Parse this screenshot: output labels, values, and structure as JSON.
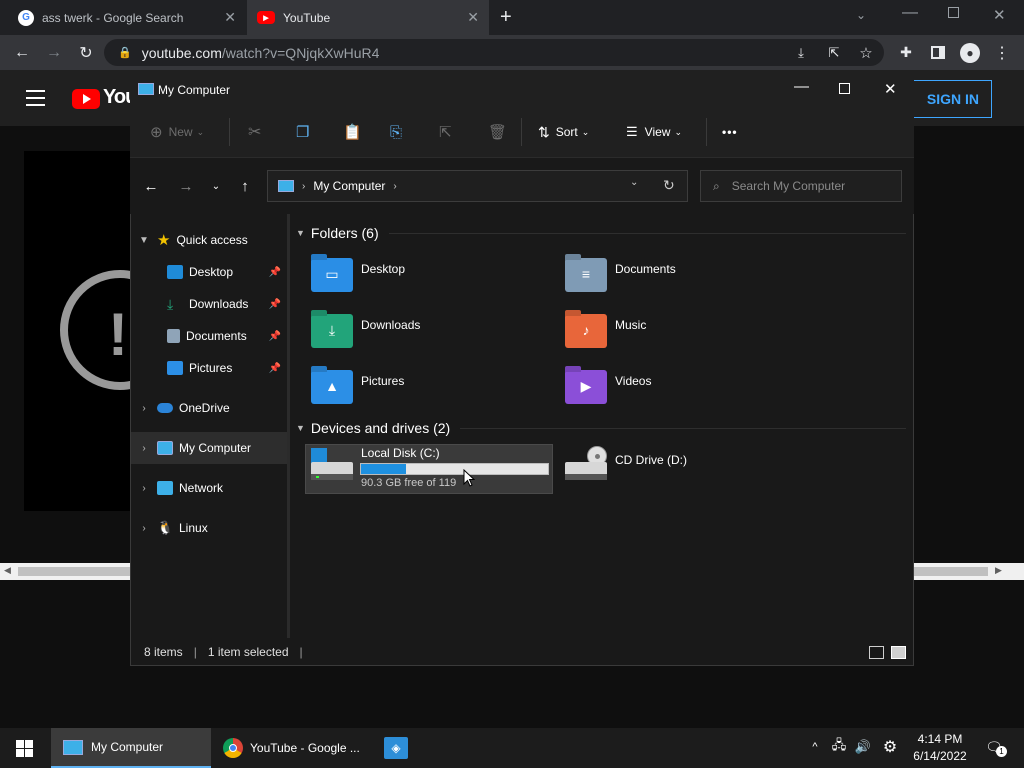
{
  "browser": {
    "tabs": [
      {
        "title": "ass twerk - Google Search",
        "favicon": "google-icon"
      },
      {
        "title": "YouTube",
        "favicon": "youtube-icon"
      }
    ],
    "url_host": "youtube.com",
    "url_path": "/watch?v=QNjqkXwHuR4"
  },
  "youtube": {
    "logo_text": "You",
    "signin_label": "SIGN IN"
  },
  "explorer": {
    "title": "My Computer",
    "command_bar": {
      "new_label": "New",
      "sort_label": "Sort",
      "view_label": "View",
      "more_label": "•••"
    },
    "address": {
      "location": "My Computer",
      "search_placeholder": "Search My Computer"
    },
    "sidebar": [
      {
        "label": "Quick access",
        "icon": "star-icon",
        "level": 0,
        "expanded": true
      },
      {
        "label": "Desktop",
        "icon": "desktop-icon",
        "level": 1,
        "pinned": true
      },
      {
        "label": "Downloads",
        "icon": "download-icon",
        "level": 1,
        "pinned": true
      },
      {
        "label": "Documents",
        "icon": "document-icon",
        "level": 1,
        "pinned": true
      },
      {
        "label": "Pictures",
        "icon": "picture-icon",
        "level": 1,
        "pinned": true
      },
      {
        "label": "OneDrive",
        "icon": "cloud-icon",
        "level": 0
      },
      {
        "label": "My Computer",
        "icon": "computer-icon",
        "level": 0,
        "selected": true
      },
      {
        "label": "Network",
        "icon": "network-icon",
        "level": 0
      },
      {
        "label": "Linux",
        "icon": "linux-icon",
        "level": 0
      }
    ],
    "folders_header": "Folders (6)",
    "folders": [
      {
        "label": "Desktop",
        "icon": "desktop-folder-icon",
        "color": "#2a8ee6"
      },
      {
        "label": "Documents",
        "icon": "documents-folder-icon",
        "color": "#7f9bb5"
      },
      {
        "label": "Downloads",
        "icon": "downloads-folder-icon",
        "color": "#22a47a"
      },
      {
        "label": "Music",
        "icon": "music-folder-icon",
        "color": "#e8663a"
      },
      {
        "label": "Pictures",
        "icon": "pictures-folder-icon",
        "color": "#2c8fe6"
      },
      {
        "label": "Videos",
        "icon": "videos-folder-icon",
        "color": "#8b4fd8"
      }
    ],
    "drives_header": "Devices and drives (2)",
    "drives": [
      {
        "name": "Local Disk (C:)",
        "free_text": "90.3 GB free of 119",
        "used_fraction": 0.24
      },
      {
        "name": "CD Drive (D:)"
      }
    ],
    "status": {
      "items": "8 items",
      "selected": "1 item selected"
    }
  },
  "taskbar": {
    "items": [
      {
        "label": "My Computer",
        "icon": "computer-icon",
        "active": true
      },
      {
        "label": "YouTube - Google ...",
        "icon": "chrome-icon"
      },
      {
        "label": "",
        "icon": "app-icon"
      }
    ],
    "time": "4:14 PM",
    "date": "6/14/2022"
  }
}
